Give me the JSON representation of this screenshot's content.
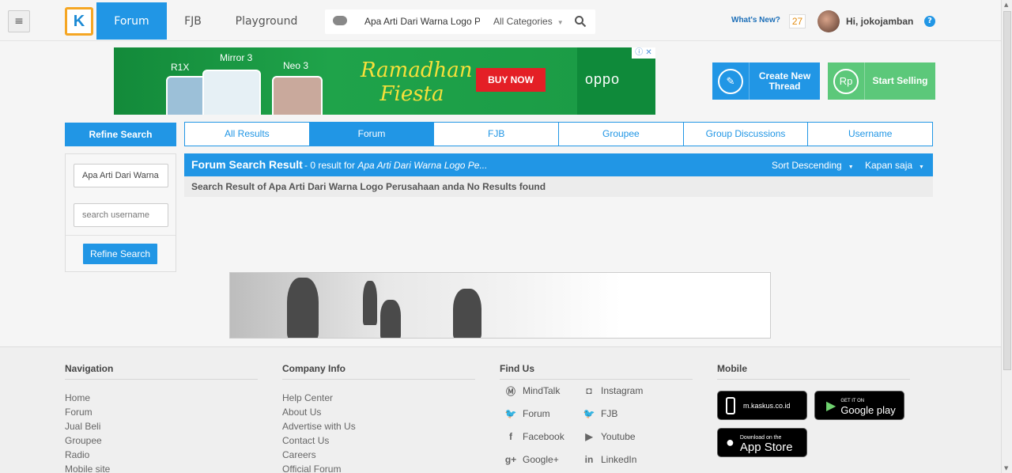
{
  "header": {
    "logo_letter": "K",
    "tabs": [
      {
        "label": "Forum",
        "active": true
      },
      {
        "label": "FJB",
        "active": false
      },
      {
        "label": "Playground",
        "active": false
      }
    ],
    "search": {
      "query": "Apa Arti Dari Warna Logo P",
      "category": "All Categories"
    },
    "whats_new": "What's New?",
    "notification_count": "27",
    "greeting": "Hi, jokojamban",
    "help": "?"
  },
  "ad_banner": {
    "models": [
      "R1X",
      "Mirror 3",
      "Neo 3"
    ],
    "headline_1": "Ramadhan",
    "headline_2": "Fiesta",
    "cta": "BUY NOW",
    "brand": "oppo"
  },
  "actions": {
    "create_thread_1": "Create New",
    "create_thread_2": "Thread",
    "start_selling": "Start Selling",
    "rp_symbol": "Rp"
  },
  "refine": {
    "title": "Refine Search",
    "keyword_value": "Apa Arti Dari Warna",
    "username_placeholder": "search username",
    "button": "Refine Search"
  },
  "result_tabs": [
    {
      "label": "All Results",
      "active": false
    },
    {
      "label": "Forum",
      "active": true
    },
    {
      "label": "FJB",
      "active": false
    },
    {
      "label": "Groupee",
      "active": false
    },
    {
      "label": "Group Discussions",
      "active": false
    },
    {
      "label": "Username",
      "active": false
    }
  ],
  "results": {
    "title": "Forum Search Result",
    "count_text": "- 0 result for ",
    "count_query": "Apa Arti Dari Warna Logo Pe...",
    "sort": "Sort Descending",
    "time_filter": "Kapan saja",
    "message": "Search Result of Apa Arti Dari Warna Logo Perusahaan anda No Results found"
  },
  "footer": {
    "navigation": {
      "title": "Navigation",
      "links": [
        "Home",
        "Forum",
        "Jual Beli",
        "Groupee",
        "Radio",
        "Mobile site"
      ]
    },
    "company": {
      "title": "Company Info",
      "links": [
        "Help Center",
        "About Us",
        "Advertise with Us",
        "Contact Us",
        "Careers",
        "Official Forum"
      ]
    },
    "find_us": {
      "title": "Find Us",
      "left": [
        "MindTalk",
        "Forum",
        "Facebook",
        "Google+"
      ],
      "right": [
        "Instagram",
        "FJB",
        "Youtube",
        "LinkedIn"
      ]
    },
    "mobile": {
      "title": "Mobile",
      "mkaskus": "m.kaskus.co.id",
      "gplay_small": "GET IT ON",
      "gplay_big": "Google play",
      "appstore_small": "Download on the",
      "appstore_big": "App Store"
    }
  },
  "colors": {
    "primary": "#2196e5",
    "create_thread": "#2196e5",
    "start_selling": "#5cc87a",
    "banner_green": "#1fa34a"
  }
}
